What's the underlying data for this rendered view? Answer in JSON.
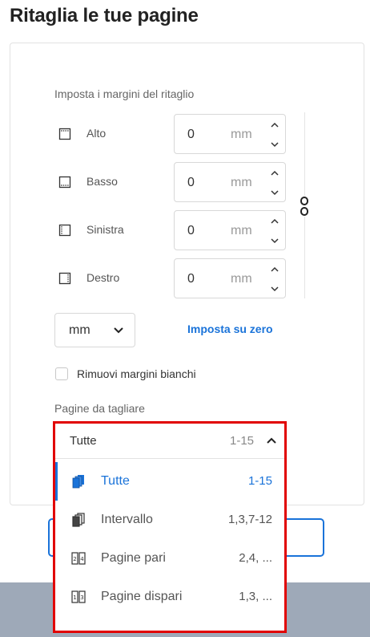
{
  "page_title": "Ritaglia le tue pagine",
  "margins": {
    "section_label": "Imposta i margini del ritaglio",
    "rows": [
      {
        "label": "Alto",
        "value": "0",
        "unit": "mm"
      },
      {
        "label": "Basso",
        "value": "0",
        "unit": "mm"
      },
      {
        "label": "Sinistra",
        "value": "0",
        "unit": "mm"
      },
      {
        "label": "Destro",
        "value": "0",
        "unit": "mm"
      }
    ]
  },
  "unit_select": {
    "value": "mm"
  },
  "reset_link": "Imposta su zero",
  "remove_white_margins": {
    "label": "Rimuovi margini bianchi",
    "checked": false
  },
  "pages": {
    "label": "Pagine da tagliare",
    "selected": {
      "label": "Tutte",
      "range": "1-15"
    },
    "options": [
      {
        "label": "Tutte",
        "range": "1-15",
        "active": true,
        "icon": "all-pages-icon"
      },
      {
        "label": "Intervallo",
        "range": "1,3,7-12",
        "active": false,
        "icon": "range-pages-icon"
      },
      {
        "label": "Pagine pari",
        "range": "2,4, ...",
        "active": false,
        "icon": "even-pages-icon"
      },
      {
        "label": "Pagine dispari",
        "range": "1,3, ...",
        "active": false,
        "icon": "odd-pages-icon"
      }
    ]
  },
  "colors": {
    "accent": "#1a73d9",
    "highlight": "#e10000",
    "footer": "#9ea9b8"
  }
}
